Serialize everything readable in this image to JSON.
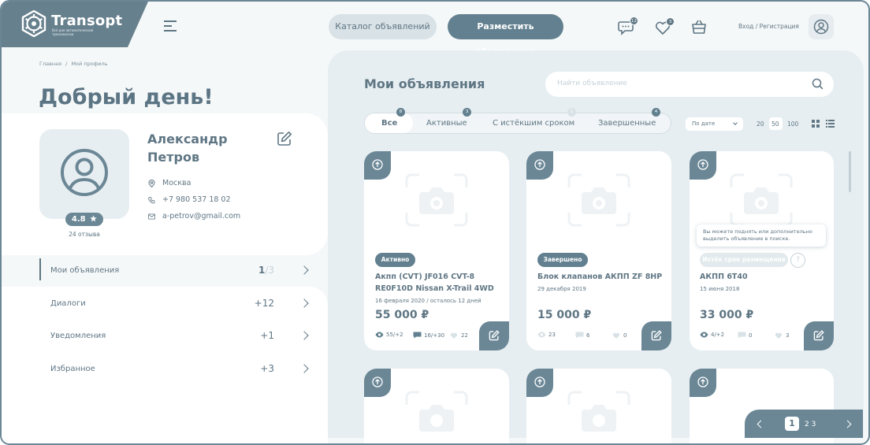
{
  "header": {
    "logo_title": "Transopt",
    "logo_subtitle": "Всё для автоматической трансмиссии",
    "catalog_button": "Каталог объявлений",
    "post_button": "Разместить объявление",
    "messages_count": "12",
    "favorites_count": "3",
    "login_link": "Вход / Регистрация"
  },
  "breadcrumbs": {
    "home": "Главная",
    "separator": "/",
    "current": "Мой профиль"
  },
  "greeting": "Добрый день!",
  "profile": {
    "first_name": "Александр",
    "last_name": "Петров",
    "city": "Москва",
    "phone": "+7 980 537 18 02",
    "email": "a-petrov@gmail.com",
    "rating": "4.8",
    "reviews": "24 отзыва"
  },
  "menu": [
    {
      "label": "Мои объявления",
      "count": "1",
      "count_total": "/3"
    },
    {
      "label": "Диалоги",
      "count": "+12"
    },
    {
      "label": "Уведомления",
      "count": "+1"
    },
    {
      "label": "Избранное",
      "count": "+3"
    }
  ],
  "ads_section": {
    "title": "Мои объявления",
    "search_placeholder": "Найти объявление",
    "tabs": [
      {
        "label": "Все",
        "count": "8"
      },
      {
        "label": "Активные",
        "count": "3"
      },
      {
        "label": "С истёкшим сроком",
        "count": "1"
      },
      {
        "label": "Завершенные",
        "count": "4"
      }
    ],
    "sort": "По дате",
    "per_page": [
      "20",
      "50",
      "100"
    ],
    "per_page_selected": "50"
  },
  "ads": [
    {
      "status": "Активно",
      "title_line1": "Акпп (CVT) JF016 CVT-8",
      "title_line2": "RE0F10D Nissan X-Trail 4WD",
      "date": "16 февраля 2020 / осталось 12 дней",
      "price": "55 000 ₽",
      "views": "55/+2",
      "messages": "16/+30",
      "likes": "22"
    },
    {
      "status": "Завершено",
      "title_line1": "Блок клапанов АКПП ZF 8HP",
      "date": "29 декабря 2019",
      "price": "15 000 ₽",
      "views": "23",
      "messages": "6",
      "likes": "0"
    },
    {
      "status": "Истёк срок размещения",
      "tooltip": "Вы можете поднять или дополнительно выделить объявление в поиске.",
      "title_line1": "АКПП 6T40",
      "date": "15 июня 2018",
      "price": "33 000 ₽",
      "views": "4/+2",
      "messages": "0",
      "likes": "3"
    }
  ],
  "pagination": {
    "current": "1",
    "pages": "2 3"
  },
  "colors": {
    "accent": "#62808f",
    "panel": "#e7eef1",
    "muted": "#c7d3d8"
  }
}
